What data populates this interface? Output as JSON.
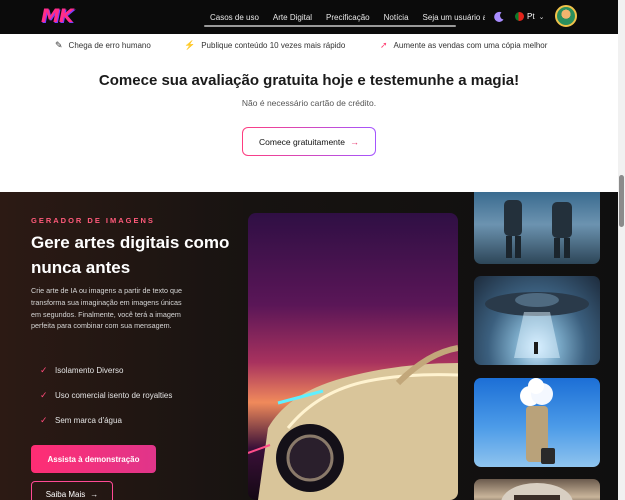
{
  "nav": {
    "logo": "MK",
    "links": [
      "Casos de uso",
      "Arte Digital",
      "Precificação",
      "Notícia",
      "Seja um usuário a"
    ],
    "language": "Pt",
    "flag": "portugal-flag-icon"
  },
  "features": [
    {
      "icon": "pencil-icon",
      "text": "Chega de erro humano"
    },
    {
      "icon": "lightning-icon",
      "text": "Publique conteúdo 10 vezes mais rápido"
    },
    {
      "icon": "rocket-icon",
      "text": "Aumente as vendas com uma cópia melhor"
    }
  ],
  "cta": {
    "title": "Comece sua avaliação gratuita hoje e testemunhe a magia!",
    "subtitle": "Não é necessário cartão de crédito.",
    "button": "Comece gratuitamente",
    "button_arrow": "→"
  },
  "generator": {
    "kicker": "GERADOR DE IMAGENS",
    "headline": "Gere artes digitais como nunca antes",
    "description": "Crie arte de IA ou imagens a partir de texto que transforma sua imaginação em imagens únicas em segundos. Finalmente, você terá a imagem perfeita para combinar com sua mensagem.",
    "checks": [
      "Isolamento Diverso",
      "Uso comercial isento de royalties",
      "Sem marca d'água"
    ],
    "demo_button": "Assista à demonstração",
    "more_button": "Saiba Mais",
    "more_arrow": "→"
  },
  "colors": {
    "accent_pink": "#ff2d74",
    "accent_purple": "#a455ff",
    "dark_bg": "#0f0f0f"
  }
}
